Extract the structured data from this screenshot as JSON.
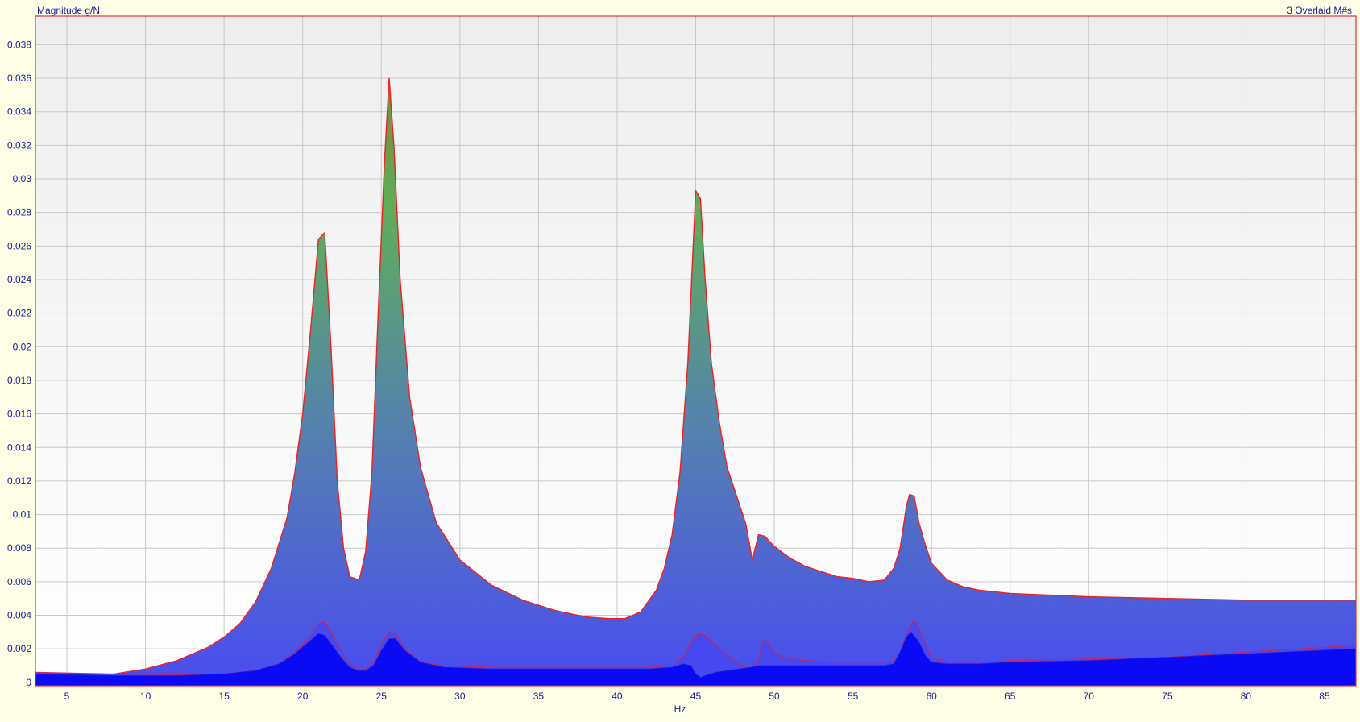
{
  "chart_data": {
    "type": "area",
    "ylabel": "Magnitude g/N",
    "xlabel": "Hz",
    "legend_text": "3 Overlaid M#s",
    "xlim": [
      3,
      87
    ],
    "ylim": [
      -0.0002,
      0.0397
    ],
    "x_ticks": [
      5,
      10,
      15,
      20,
      25,
      30,
      35,
      40,
      45,
      50,
      55,
      60,
      65,
      70,
      75,
      80,
      85
    ],
    "y_ticks": [
      0,
      0.002,
      0.004,
      0.006,
      0.008,
      0.01,
      0.012,
      0.014,
      0.016,
      0.018,
      0.02,
      0.022,
      0.024,
      0.026,
      0.028,
      0.03,
      0.032,
      0.034,
      0.036,
      0.038
    ],
    "y_tick_labels": [
      "0",
      "0.002",
      "0.004",
      "0.006",
      "0.008",
      "0.01",
      "0.012",
      "0.014",
      "0.016",
      "0.018",
      "0.02",
      "0.022",
      "0.024",
      "0.026",
      "0.028",
      "0.03",
      "0.032",
      "0.034",
      "0.036",
      "0.038"
    ],
    "grid": true,
    "series": [
      {
        "x": [
          3,
          5,
          7,
          8,
          10,
          12,
          14,
          15,
          16,
          17,
          18,
          19,
          19.5,
          20,
          20.5,
          21,
          21.4,
          21.8,
          22.2,
          22.6,
          23,
          23.6,
          24,
          24.4,
          24.8,
          25.2,
          25.5,
          25.8,
          26.2,
          26.8,
          27.5,
          28.5,
          30,
          32,
          34,
          36,
          38,
          39.5,
          40.5,
          41.5,
          42.5,
          43,
          43.5,
          44,
          44.5,
          45,
          45.3,
          45.6,
          46,
          46.5,
          47,
          47.5,
          48.2,
          48.6,
          49,
          49.4,
          50,
          51,
          52,
          53,
          54,
          55,
          56,
          57,
          57.6,
          58,
          58.4,
          58.6,
          58.9,
          59.2,
          59.6,
          60,
          61,
          62,
          63,
          65,
          70,
          75,
          80,
          87
        ],
        "y": [
          5e-05,
          0.00025,
          0.0004,
          0.0005,
          0.0008,
          0.0013,
          0.0021,
          0.0027,
          0.0035,
          0.0048,
          0.0068,
          0.0098,
          0.0125,
          0.016,
          0.021,
          0.0264,
          0.0268,
          0.02,
          0.012,
          0.008,
          0.0063,
          0.0061,
          0.0078,
          0.0125,
          0.022,
          0.031,
          0.036,
          0.032,
          0.024,
          0.017,
          0.0128,
          0.0095,
          0.0073,
          0.0058,
          0.0049,
          0.0043,
          0.0039,
          0.0038,
          0.0038,
          0.0042,
          0.0055,
          0.0068,
          0.0088,
          0.0125,
          0.019,
          0.0293,
          0.0288,
          0.024,
          0.019,
          0.0155,
          0.0128,
          0.0114,
          0.0094,
          0.0073,
          0.0088,
          0.0087,
          0.0081,
          0.0074,
          0.0069,
          0.0066,
          0.0063,
          0.0062,
          0.006,
          0.0061,
          0.0068,
          0.008,
          0.0105,
          0.0112,
          0.0111,
          0.0095,
          0.0082,
          0.0071,
          0.0061,
          0.0057,
          0.0055,
          0.0053,
          0.0051,
          0.005,
          0.0049,
          0.0049
        ]
      },
      {
        "x": [
          3,
          8,
          12,
          15,
          17,
          18.5,
          19.5,
          20.5,
          21,
          21.4,
          21.8,
          22.5,
          23,
          23.5,
          24,
          24.5,
          25,
          25.5,
          25.9,
          26.5,
          27.5,
          29,
          32,
          36,
          40,
          42,
          43.5,
          44.3,
          44.8,
          45.2,
          45.6,
          46.3,
          47,
          47.8,
          48.5,
          49,
          49.3,
          49.6,
          50,
          51,
          52,
          54,
          56,
          57,
          57.6,
          58,
          58.4,
          58.7,
          58.9,
          59.2,
          59.6,
          60,
          61,
          63,
          65,
          70,
          75,
          80,
          87
        ],
        "y": [
          0.0006,
          0.0005,
          0.00045,
          0.0005,
          0.0007,
          0.0011,
          0.0018,
          0.0028,
          0.0035,
          0.0036,
          0.003,
          0.0018,
          0.0011,
          0.0008,
          0.0008,
          0.0012,
          0.0023,
          0.003,
          0.0029,
          0.002,
          0.0012,
          0.001,
          0.0009,
          0.0009,
          0.0009,
          0.0009,
          0.001,
          0.0016,
          0.0025,
          0.0029,
          0.0028,
          0.0022,
          0.0016,
          0.0011,
          0.0008,
          0.0013,
          0.0025,
          0.0024,
          0.0017,
          0.0014,
          0.0013,
          0.0012,
          0.0012,
          0.0012,
          0.0013,
          0.0018,
          0.0028,
          0.0034,
          0.0037,
          0.0033,
          0.0023,
          0.0015,
          0.0012,
          0.0012,
          0.0013,
          0.0014,
          0.0015,
          0.0018,
          0.0022
        ]
      },
      {
        "x": [
          3,
          8,
          12,
          15,
          17,
          18.5,
          19.5,
          20.5,
          21,
          21.4,
          21.8,
          22.5,
          23,
          23.5,
          24,
          24.5,
          25,
          25.5,
          25.9,
          26.5,
          27.5,
          29,
          32,
          36,
          40,
          42,
          43.5,
          44.2,
          44.7,
          45,
          45.3,
          45.6,
          46.3,
          47,
          47.8,
          48.5,
          49,
          49.4,
          50,
          51,
          52,
          54,
          56,
          57,
          57.6,
          58,
          58.4,
          58.7,
          59.2,
          59.6,
          60,
          61,
          63,
          65,
          70,
          75,
          80,
          87
        ],
        "y": [
          0.0005,
          0.0004,
          0.0004,
          0.0005,
          0.0007,
          0.0011,
          0.0017,
          0.0025,
          0.0029,
          0.0028,
          0.0023,
          0.0014,
          0.0009,
          0.0007,
          0.0007,
          0.001,
          0.0019,
          0.0026,
          0.0026,
          0.0019,
          0.0012,
          0.0009,
          0.0008,
          0.0008,
          0.0008,
          0.0008,
          0.0009,
          0.0011,
          0.001,
          0.0005,
          0.0003,
          0.0004,
          0.0006,
          0.0007,
          0.0008,
          0.0009,
          0.001,
          0.001,
          0.001,
          0.001,
          0.001,
          0.001,
          0.001,
          0.001,
          0.0011,
          0.0018,
          0.0027,
          0.003,
          0.0024,
          0.0016,
          0.0012,
          0.0011,
          0.0011,
          0.0012,
          0.0013,
          0.0015,
          0.0017,
          0.002
        ]
      }
    ]
  }
}
